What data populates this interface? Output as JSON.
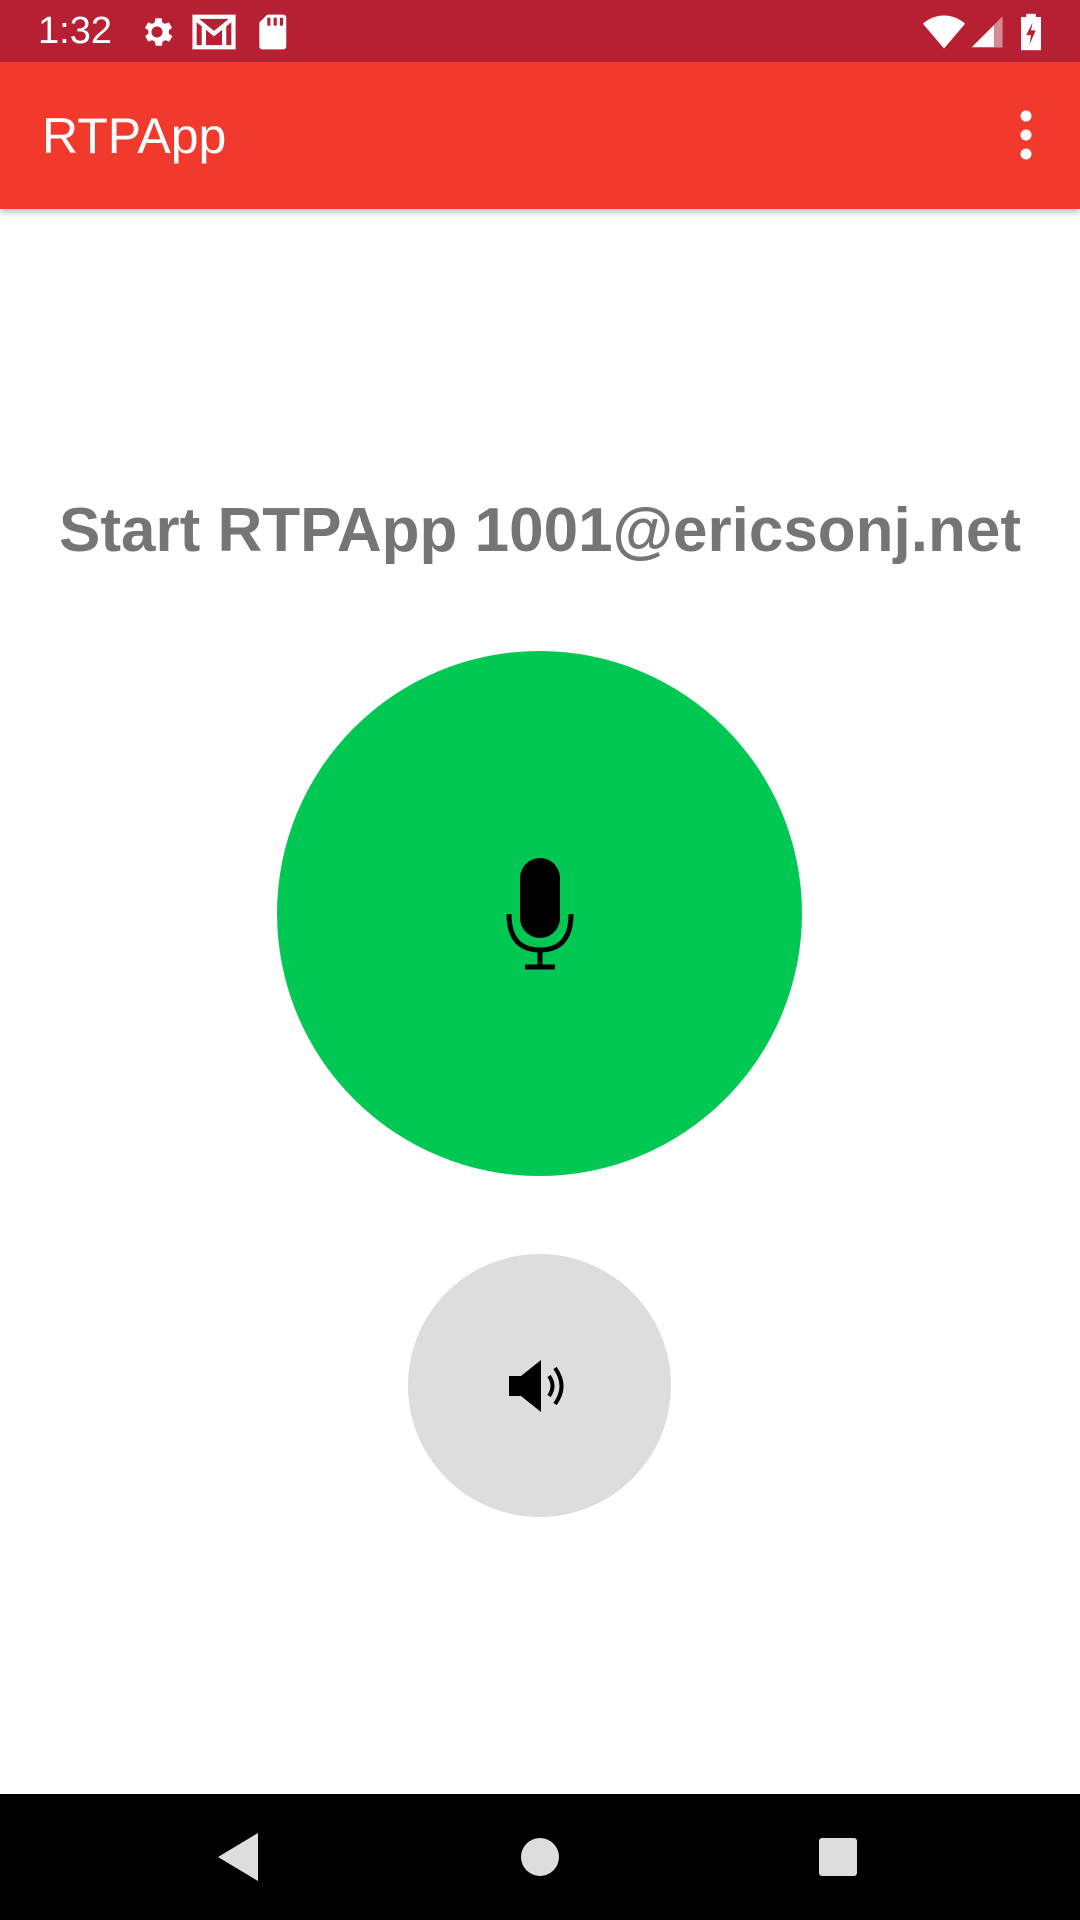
{
  "status_bar": {
    "time": "1:32",
    "background_color": "#B71F32",
    "left_icons": [
      "settings-gear-icon",
      "gmail-icon",
      "sd-card-icon"
    ],
    "right_icons": [
      "wifi-icon",
      "cell-signal-icon",
      "battery-charging-icon"
    ]
  },
  "app_bar": {
    "title": "RTPApp",
    "background_color": "#F13A2C",
    "menu_icon": "more-vert-icon"
  },
  "main": {
    "headline": "Start RTPApp 1001@ericsonj.net",
    "mic_button": {
      "icon": "microphone-icon",
      "color": "#00C853"
    },
    "speaker_button": {
      "icon": "speaker-volume-icon",
      "color": "#DDDDDD"
    }
  },
  "nav_bar": {
    "buttons": [
      "back-icon",
      "home-icon",
      "recents-icon"
    ]
  }
}
